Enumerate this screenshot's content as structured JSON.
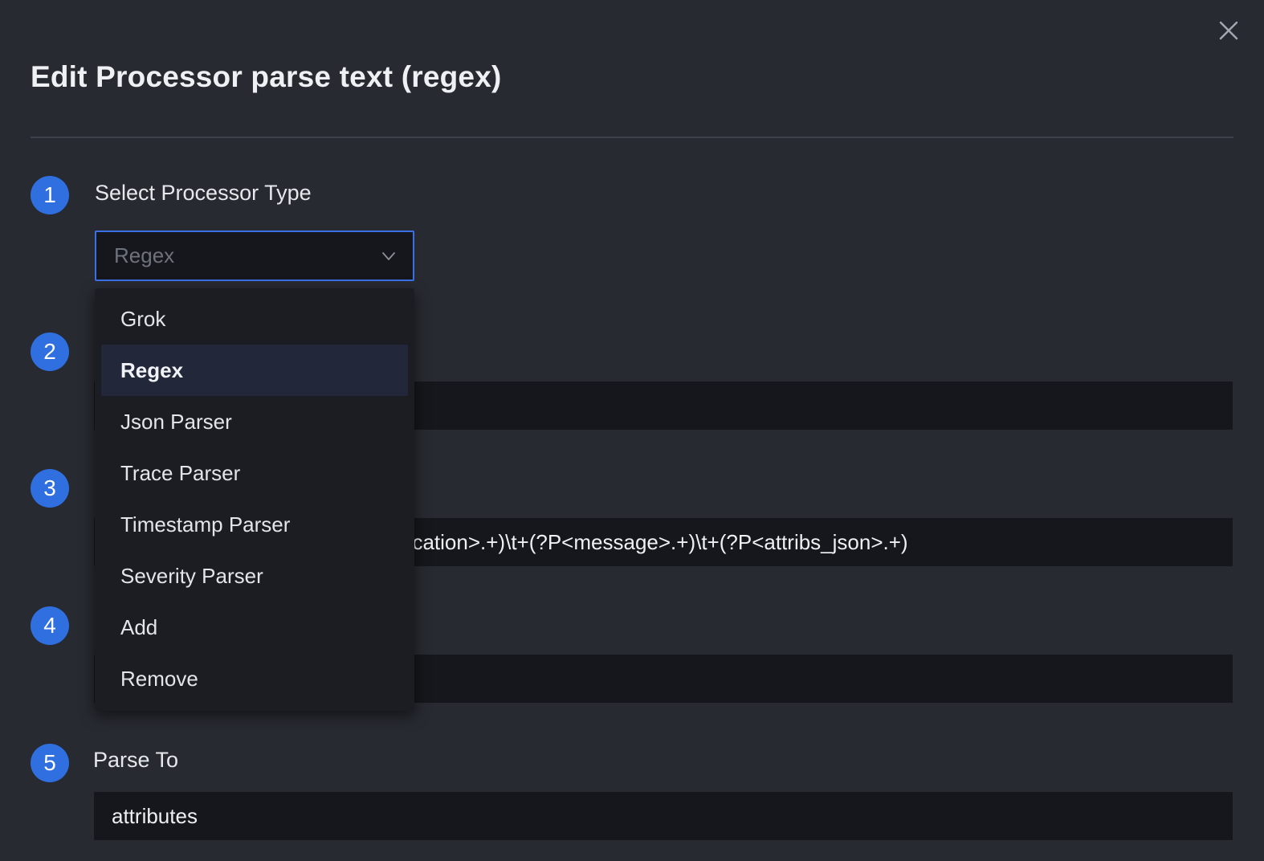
{
  "modal": {
    "title": "Edit Processor parse text (regex)"
  },
  "steps": [
    {
      "number": "1",
      "label": "Select Processor Type"
    },
    {
      "number": "2"
    },
    {
      "number": "3"
    },
    {
      "number": "4"
    },
    {
      "number": "5",
      "label": "Parse To"
    }
  ],
  "processor_type": {
    "selected_value": "Regex",
    "options": [
      "Grok",
      "Regex",
      "Json Parser",
      "Trace Parser",
      "Timestamp Parser",
      "Severity Parser",
      "Add",
      "Remove"
    ],
    "selected_index": 1
  },
  "fields": {
    "regex_pattern_visible": "ocation>.+)\\t+(?P<message>.+)\\t+(?P<attribs_json>.+)",
    "parse_to_value": "attributes"
  },
  "colors": {
    "background": "#272a31",
    "field_background": "#15171c",
    "accent": "#2f6fe0",
    "select_border": "#3b6fe6"
  },
  "icons": {
    "close": "close-icon",
    "chevron": "chevron-down-icon"
  }
}
